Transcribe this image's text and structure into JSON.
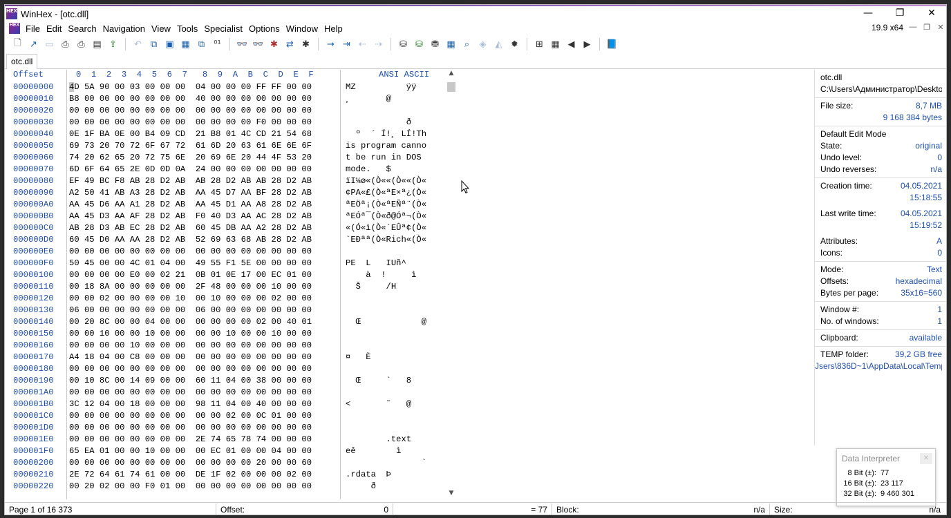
{
  "window": {
    "title": "WinHex - [otc.dll]",
    "version": "19.9 x64",
    "icon_text": "HEX"
  },
  "menu": [
    "File",
    "Edit",
    "Search",
    "Navigation",
    "View",
    "Tools",
    "Specialist",
    "Options",
    "Window",
    "Help"
  ],
  "tab": "otc.dll",
  "editor": {
    "offset_header": "Offset",
    "hex_header": "0  1  2  3  4  5  6  7   8  9  A  B  C  D  E  F",
    "ansi_header": "ANSI ASCII",
    "offsets": [
      "00000000",
      "00000010",
      "00000020",
      "00000030",
      "00000040",
      "00000050",
      "00000060",
      "00000070",
      "00000080",
      "00000090",
      "000000A0",
      "000000B0",
      "000000C0",
      "000000D0",
      "000000E0",
      "000000F0",
      "00000100",
      "00000110",
      "00000120",
      "00000130",
      "00000140",
      "00000150",
      "00000160",
      "00000170",
      "00000180",
      "00000190",
      "000001A0",
      "000001B0",
      "000001C0",
      "000001D0",
      "000001E0",
      "000001F0",
      "00000200",
      "00000210",
      "00000220"
    ],
    "hex": [
      "4D 5A 90 00 03 00 00 00  04 00 00 00 FF FF 00 00",
      "B8 00 00 00 00 00 00 00  40 00 00 00 00 00 00 00",
      "00 00 00 00 00 00 00 00  00 00 00 00 00 00 00 00",
      "00 00 00 00 00 00 00 00  00 00 00 00 F0 00 00 00",
      "0E 1F BA 0E 00 B4 09 CD  21 B8 01 4C CD 21 54 68",
      "69 73 20 70 72 6F 67 72  61 6D 20 63 61 6E 6E 6F",
      "74 20 62 65 20 72 75 6E  20 69 6E 20 44 4F 53 20",
      "6D 6F 64 65 2E 0D 0D 0A  24 00 00 00 00 00 00 00",
      "EF 49 BC F8 AB 28 D2 AB  AB 28 D2 AB AB 28 D2 AB",
      "A2 50 41 AB A3 28 D2 AB  AA 45 D7 AA BF 28 D2 AB",
      "AA 45 D6 AA A1 28 D2 AB  AA 45 D1 AA A8 28 D2 AB",
      "AA 45 D3 AA AF 28 D2 AB  F0 40 D3 AA AC 28 D2 AB",
      "AB 28 D3 AB EC 28 D2 AB  60 45 DB AA A2 28 D2 AB",
      "60 45 D0 AA AA 28 D2 AB  52 69 63 68 AB 28 D2 AB",
      "00 00 00 00 00 00 00 00  00 00 00 00 00 00 00 00",
      "50 45 00 00 4C 01 04 00  49 55 F1 5E 00 00 00 00",
      "00 00 00 00 E0 00 02 21  0B 01 0E 17 00 EC 01 00",
      "00 18 8A 00 00 00 00 00  2F 48 00 00 00 10 00 00",
      "00 00 02 00 00 00 00 10  00 10 00 00 00 02 00 00",
      "06 00 00 00 00 00 00 00  06 00 00 00 00 00 00 00",
      "00 20 8C 00 00 04 00 00  00 00 00 00 02 00 40 01",
      "00 00 10 00 00 10 00 00  00 00 10 00 00 10 00 00",
      "00 00 00 00 10 00 00 00  00 00 00 00 00 00 00 00",
      "A4 18 04 00 C8 00 00 00  00 00 00 00 00 00 00 00",
      "00 00 00 00 00 00 00 00  00 00 00 00 00 00 00 00",
      "00 10 8C 00 14 09 00 00  60 11 04 00 38 00 00 00",
      "00 00 00 00 00 00 00 00  00 00 00 00 00 00 00 00",
      "3C 12 04 00 18 00 00 00  98 11 04 00 40 00 00 00",
      "00 00 00 00 00 00 00 00  00 00 02 00 0C 01 00 00",
      "00 00 00 00 00 00 00 00  00 00 00 00 00 00 00 00",
      "00 00 00 00 00 00 00 00  2E 74 65 78 74 00 00 00",
      "65 EA 01 00 00 10 00 00  00 EC 01 00 00 04 00 00",
      "00 00 00 00 00 00 00 00  00 00 00 00 20 00 00 60",
      "2E 72 64 61 74 61 00 00  DE 1F 02 00 00 00 02 00",
      "00 20 02 00 00 F0 01 00  00 00 00 00 00 00 00 00"
    ],
    "ascii": [
      "MZ          ÿÿ",
      "¸       @",
      "",
      "            ð",
      "  º  ´ Í!¸ LÍ!Th",
      "is program canno",
      "t be run in DOS",
      "mode.   $",
      "ïI¼ø«(Ò««(Ò««(Ò«",
      "¢PA«£(Ò«ªE×ª¿(Ò«",
      "ªEÖª¡(Ò«ªEÑª¨(Ò«",
      "ªEÓª¯(Ò«ð@Óª¬(Ò«",
      "«(Ó«ì(Ò«`EÛª¢(Ò«",
      "`EÐªª(Ò«Rich«(Ò«",
      "",
      "PE  L   IUñ^",
      "    à  !     ì",
      "  Š     /H",
      "",
      "",
      "  Œ            @",
      "",
      "",
      "¤   È",
      "",
      "  Œ     `   8",
      "",
      "<       ˜   @",
      "",
      "",
      "        .text",
      "eê        ì",
      "               `",
      ".rdata  Þ",
      "     ð"
    ]
  },
  "info": {
    "filename": "otc.dll",
    "path": "C:\\Users\\Администратор\\Desktop",
    "file_size_label": "File size:",
    "file_size_mb": "8,7 MB",
    "file_size_bytes": "9 168 384 bytes",
    "edit_mode": "Default Edit Mode",
    "state_label": "State:",
    "state": "original",
    "undo_level_label": "Undo level:",
    "undo_level": "0",
    "undo_reverses_label": "Undo reverses:",
    "undo_reverses": "n/a",
    "creation_label": "Creation time:",
    "creation_date": "04.05.2021",
    "creation_time": "15:18:55",
    "lastwrite_label": "Last write time:",
    "lastwrite_date": "04.05.2021",
    "lastwrite_time": "15:19:52",
    "attributes_label": "Attributes:",
    "attributes": "A",
    "icons_label": "Icons:",
    "icons": "0",
    "mode_label": "Mode:",
    "mode": "Text",
    "offsets_label": "Offsets:",
    "offsets": "hexadecimal",
    "bpp_label": "Bytes per page:",
    "bpp": "35x16=560",
    "window_no_label": "Window #:",
    "window_no": "1",
    "windows_label": "No. of windows:",
    "windows": "1",
    "clipboard_label": "Clipboard:",
    "clipboard": "available",
    "temp_label": "TEMP folder:",
    "temp_free": "39,2 GB free",
    "temp_path": "Jsers\\836D~1\\AppData\\Local\\Temp"
  },
  "interpreter": {
    "title": "Data Interpreter",
    "rows": [
      {
        "k": "8 Bit (±):",
        "v": "77"
      },
      {
        "k": "16 Bit (±):",
        "v": "23 117"
      },
      {
        "k": "32 Bit (±):",
        "v": "9 460 301"
      }
    ]
  },
  "status": {
    "page": "Page 1 of 16 373",
    "offset_label": "Offset:",
    "offset_value": "0",
    "value": "= 77",
    "block_label": "Block:",
    "block_value": "n/a",
    "size_label": "Size:",
    "size_value": "n/a"
  }
}
